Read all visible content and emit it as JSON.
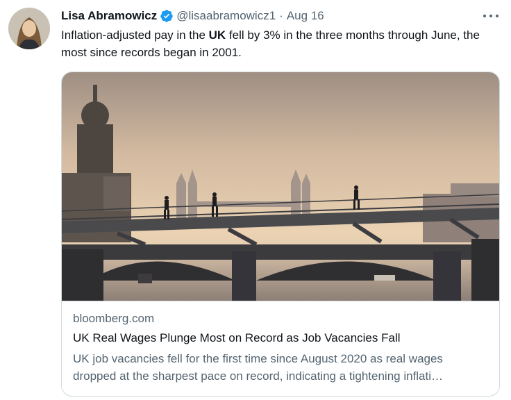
{
  "tweet": {
    "author_name": "Lisa Abramowicz",
    "handle": "@lisaabramowicz1",
    "separator": "·",
    "date": "Aug 16",
    "text_before": "Inflation-adjusted pay in the ",
    "text_bold": "UK",
    "text_after": " fell by 3% in the three months through June, the most since records began in 2001."
  },
  "card": {
    "domain": "bloomberg.com",
    "title": "UK Real Wages Plunge Most on Record as Job Vacancies Fall",
    "description_line1": "UK job vacancies fell for the first time since August 2020 as real wages",
    "description_line2": "dropped at the sharpest pace on record, indicating a tightening inflati…"
  },
  "colors": {
    "verified": "#1d9bf0",
    "secondary_text": "#536471",
    "border": "#cfd9de"
  }
}
